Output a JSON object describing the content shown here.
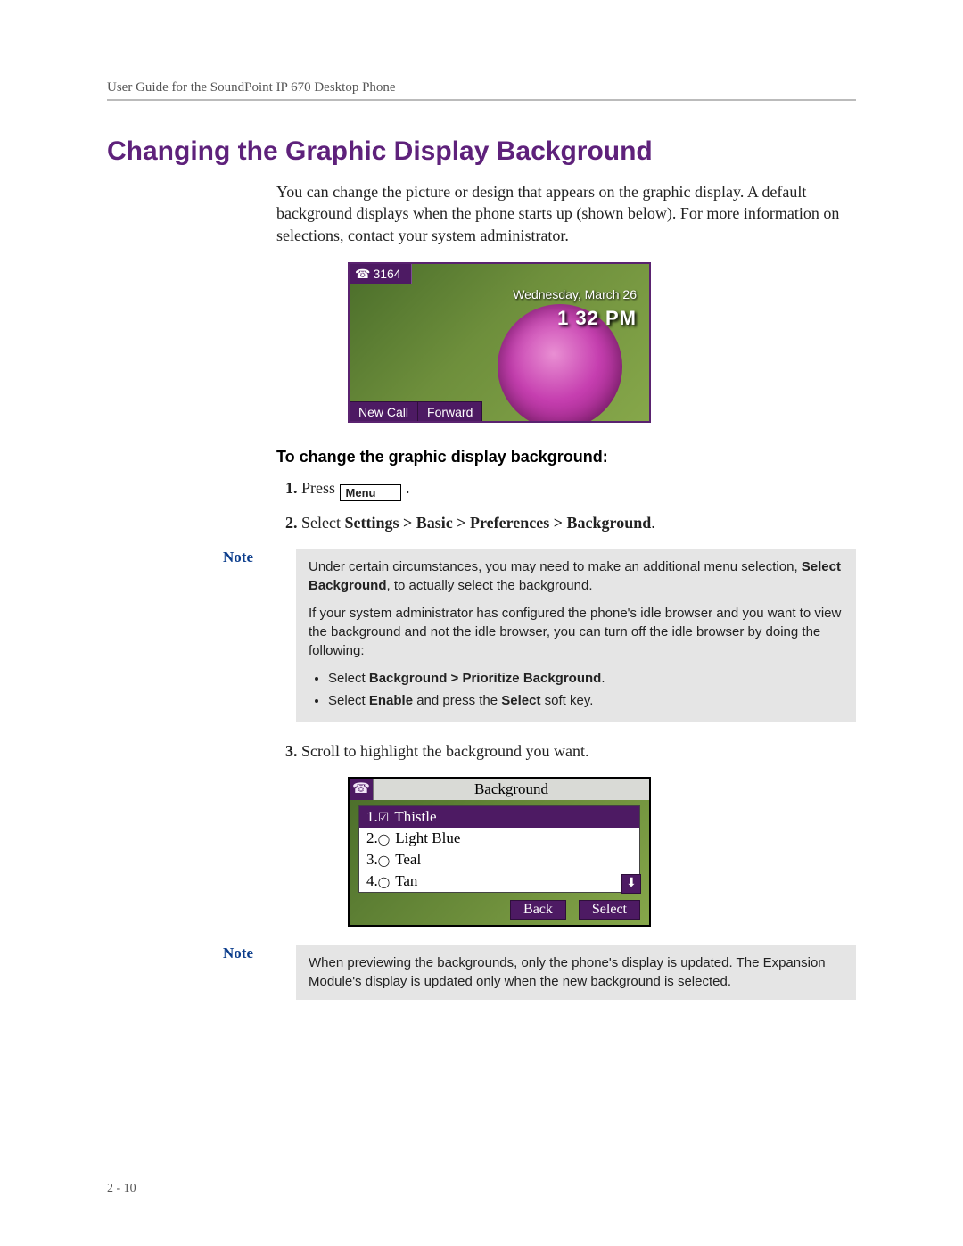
{
  "header": {
    "running": "User Guide for the SoundPoint IP 670 Desktop Phone"
  },
  "title": "Changing the Graphic Display Background",
  "intro": "You can change the picture or design that appears on the graphic display. A default background displays when the phone starts up (shown below). For more information on selections, contact your system administrator.",
  "shot1": {
    "extension": "3164",
    "date": "Wednesday, March 26",
    "time": "1 32 PM",
    "softkeys": [
      "New Call",
      "Forward"
    ]
  },
  "subhead": "To change the graphic display background:",
  "steps": {
    "one_prefix": "Press ",
    "menu_label": "Menu",
    "one_suffix": " .",
    "two_prefix": "Select ",
    "two_path": "Settings > Basic > Preferences > Background",
    "two_suffix": ".",
    "three": "Scroll to highlight the background you want."
  },
  "note1": {
    "label": "Note",
    "p1a": "Under certain circumstances, you may need to make an additional menu selection, ",
    "p1b": "Select Background",
    "p1c": ", to actually select the background.",
    "p2": "If your system administrator has configured the phone's idle browser and you want to view the background and not the idle browser, you can turn off the idle browser by doing the following:",
    "b1a": "Select ",
    "b1b": "Background > Prioritize Background",
    "b1c": ".",
    "b2a": "Select ",
    "b2b": "Enable",
    "b2c": " and press the ",
    "b2d": "Select",
    "b2e": " soft key."
  },
  "shot2": {
    "title": "Background",
    "items": [
      {
        "num": "1.",
        "label": "Thistle",
        "selected": true
      },
      {
        "num": "2.",
        "label": "Light Blue",
        "selected": false
      },
      {
        "num": "3.",
        "label": "Teal",
        "selected": false
      },
      {
        "num": "4.",
        "label": "Tan",
        "selected": false
      }
    ],
    "softkeys": [
      "Back",
      "Select"
    ]
  },
  "note2": {
    "label": "Note",
    "text": "When previewing the backgrounds, only the phone's display is updated. The Expansion Module's display is updated only when the new background is selected."
  },
  "footer": "2 - 10"
}
